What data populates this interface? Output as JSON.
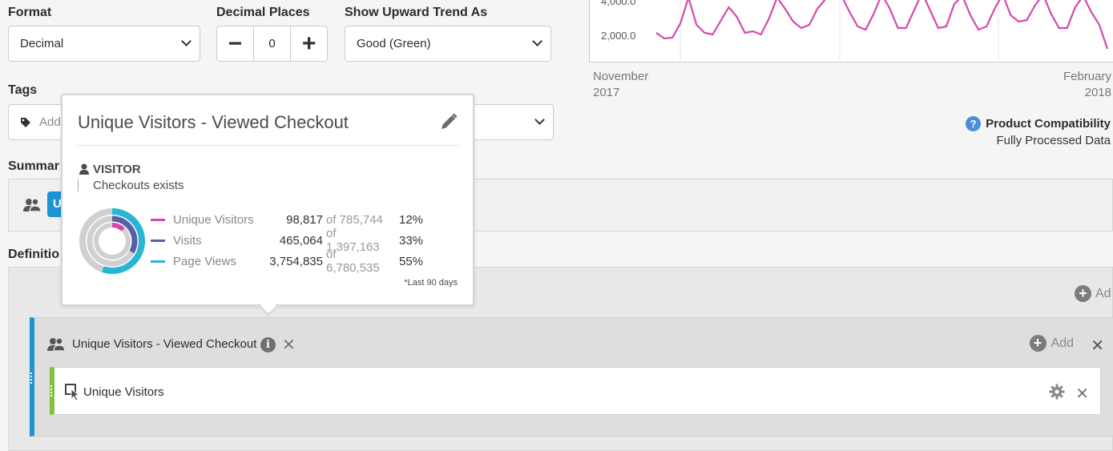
{
  "format": {
    "label": "Format",
    "value": "Decimal"
  },
  "decimal": {
    "label": "Decimal Places",
    "minus": "−",
    "value": "0",
    "plus": "+"
  },
  "trend": {
    "label": "Show Upward Trend As",
    "value": "Good (Green)"
  },
  "tags": {
    "label": "Tags",
    "placeholder": "Add"
  },
  "summary": {
    "label": "Summar"
  },
  "definition": {
    "label": "Definitio"
  },
  "chart": {
    "y_ticks": [
      "4,000.0",
      "2,000.0"
    ],
    "x_start_month": "November",
    "x_start_year": "2017",
    "x_end_month": "February",
    "x_end_year": "2018",
    "chart_data": {
      "type": "line",
      "y_ticks": [
        4000,
        2000
      ],
      "x_labels": [
        "November 2017",
        "February 2018"
      ],
      "series": [
        {
          "values": [
            2100,
            1750,
            1800,
            2700,
            4300,
            2600,
            2100,
            2000,
            2850,
            3700,
            3100,
            2100,
            2200,
            2000,
            3000,
            4300,
            3600,
            2800,
            2400,
            2600,
            3600,
            4200,
            4300,
            4400,
            3400,
            2500,
            2300,
            3300,
            4500,
            3600,
            2400,
            2400,
            3500,
            4600,
            3500,
            2400,
            2500,
            3900,
            4400,
            3200,
            2300,
            2500,
            3600,
            4500,
            3200,
            2800,
            2900,
            3800,
            4500,
            3300,
            2400,
            2400,
            3700,
            4400,
            3400,
            2600,
            1100
          ]
        }
      ],
      "color": "#d54aa8"
    }
  },
  "compat": {
    "title": "Product Compatibility",
    "value": "Fully Processed Data"
  },
  "popover": {
    "title": "Unique Visitors - Viewed Checkout",
    "section": "VISITOR",
    "condition": "Checkouts exists",
    "rows": [
      {
        "name": "Unique Visitors",
        "value": "98,817",
        "of": "of 785,744",
        "pct": "12%",
        "color": "#d54aa8"
      },
      {
        "name": "Visits",
        "value": "465,064",
        "of": "of 1,397,163",
        "pct": "33%",
        "color": "#5660a6"
      },
      {
        "name": "Page Views",
        "value": "3,754,835",
        "of": "of 6,780,535",
        "pct": "55%",
        "color": "#28b6d5"
      }
    ],
    "footnote": "*Last 90 days",
    "ring_fractions": [
      0.12,
      0.33,
      0.55
    ]
  },
  "summary_badge": "U",
  "definition_area": {
    "top_add": "Ad"
  },
  "container": {
    "title": "Unique Visitors - Viewed Checkout",
    "add": "Add"
  },
  "rule": {
    "title": "Unique Visitors"
  },
  "colors": {
    "blue": "#1b93d5",
    "green": "#80c141"
  }
}
